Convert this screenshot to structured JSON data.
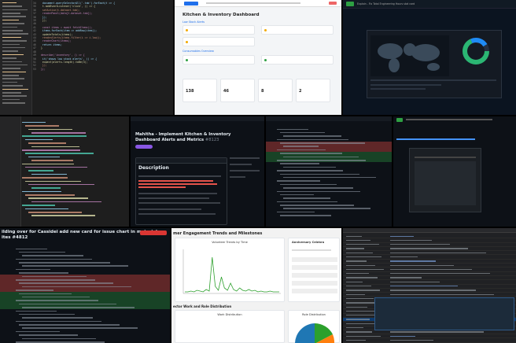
{
  "tile_tl": {
    "code": [
      {
        "n": "34",
        "t": "  document.querySelectorAll('.tab').forEach(t => {"
      },
      {
        "n": "35",
        "t": "    t.addEventListener('click', () => {"
      },
      {
        "n": "36",
        "t": "      setActive(t.dataset.tab);"
      },
      {
        "n": "37",
        "t": "      renderPanel(data[t.dataset.tab]);"
      },
      {
        "n": "38",
        "t": "    });"
      },
      {
        "n": "39",
        "t": "  });"
      },
      {
        "n": "40",
        "t": ""
      },
      {
        "n": "41",
        "t": "  const items = await fetchItems();"
      },
      {
        "n": "42",
        "t": "  items.forEach(item => addRow(item));"
      },
      {
        "n": "43",
        "t": "  updateTotals(items);"
      },
      {
        "n": "44",
        "t": "  renderAlerts(items.filter(i => i.low));"
      },
      {
        "n": "45",
        "t": "  renderChart(items);"
      },
      {
        "n": "46",
        "t": "  return items;"
      },
      {
        "n": "47",
        "t": "}"
      },
      {
        "n": "48",
        "t": ""
      },
      {
        "n": "49",
        "t": "describe('inventory', () => {"
      },
      {
        "n": "50",
        "t": "  it('shows low stock alerts', () => {"
      },
      {
        "n": "51",
        "t": "    expect(alerts.length).toBe(3);"
      },
      {
        "n": "52",
        "t": "  });"
      },
      {
        "n": "53",
        "t": "});"
      }
    ]
  },
  "tile_tm": {
    "title": "Kitchen & Inventory Dashboard",
    "section1": "Low Stock Alerts",
    "section2": "Consumables Overview",
    "stats": [
      "138",
      "46",
      "8",
      "2"
    ]
  },
  "tile_tr": {
    "title": "Sawmill",
    "pr_title": "Explain - Fix Total Engineering Hours stat card"
  },
  "tile_ml": {},
  "tile_mm": {
    "title": "Mahitha - Implement Kitchen & Inventory Dashboard Alerts and Metrics",
    "num": "#8123",
    "description": "Description"
  },
  "tile_mr": {},
  "tile_bl": {
    "title_line1": "ilding over for Cassidei add new card for issue chart in material",
    "title_line2": "ites #4812"
  },
  "tile_bm": {
    "title": "mer Engagement Trends and Milestones",
    "chart_title": "Volunteer Trends by Time",
    "chart2_title": "Work Distribution",
    "section2": "ector Work and Role Distribution",
    "right_title": "Anniversary Celebra",
    "right2_title": "Role Distribution"
  },
  "tile_br": {}
}
